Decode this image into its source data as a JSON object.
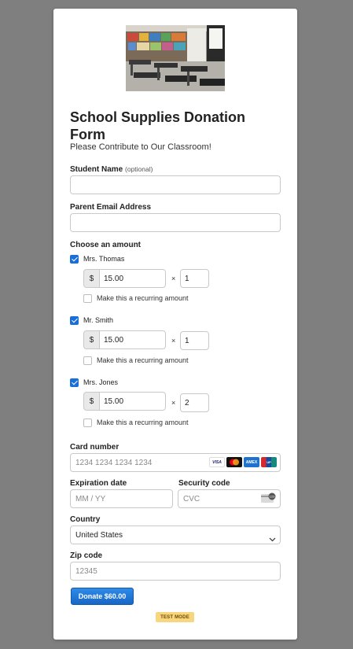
{
  "form": {
    "title": "School Supplies Donation Form",
    "subtitle": "Please Contribute to Our Classroom!",
    "image_alt": "classroom photo"
  },
  "fields": {
    "student_name_label": "Student Name",
    "student_name_optional": "(optional)",
    "student_name_value": "",
    "parent_email_label": "Parent Email Address",
    "parent_email_value": ""
  },
  "amounts": {
    "label": "Choose an amount",
    "currency_symbol": "$",
    "times": "×",
    "recurring_label": "Make this a recurring amount",
    "items": [
      {
        "name": "Mrs. Thomas",
        "checked": true,
        "amount": "15.00",
        "qty": "1",
        "recurring": false
      },
      {
        "name": "Mr. Smith",
        "checked": true,
        "amount": "15.00",
        "qty": "1",
        "recurring": false
      },
      {
        "name": "Mrs. Jones",
        "checked": true,
        "amount": "15.00",
        "qty": "2",
        "recurring": false
      }
    ]
  },
  "payment": {
    "card_number_label": "Card number",
    "card_number_placeholder": "1234 1234 1234 1234",
    "card_brands": [
      "VISA",
      "Mastercard",
      "AMEX",
      "UnionPay"
    ],
    "expiry_label": "Expiration date",
    "expiry_placeholder": "MM / YY",
    "cvc_label": "Security code",
    "cvc_placeholder": "CVC",
    "country_label": "Country",
    "country_value": "United States",
    "zip_label": "Zip code",
    "zip_placeholder": "12345"
  },
  "actions": {
    "donate_label": "Donate $60.00",
    "test_mode_badge": "TEST MODE"
  },
  "colors": {
    "accent": "#1a6ed8",
    "page_bg": "#7f7f7f",
    "badge": "#f8d680"
  }
}
